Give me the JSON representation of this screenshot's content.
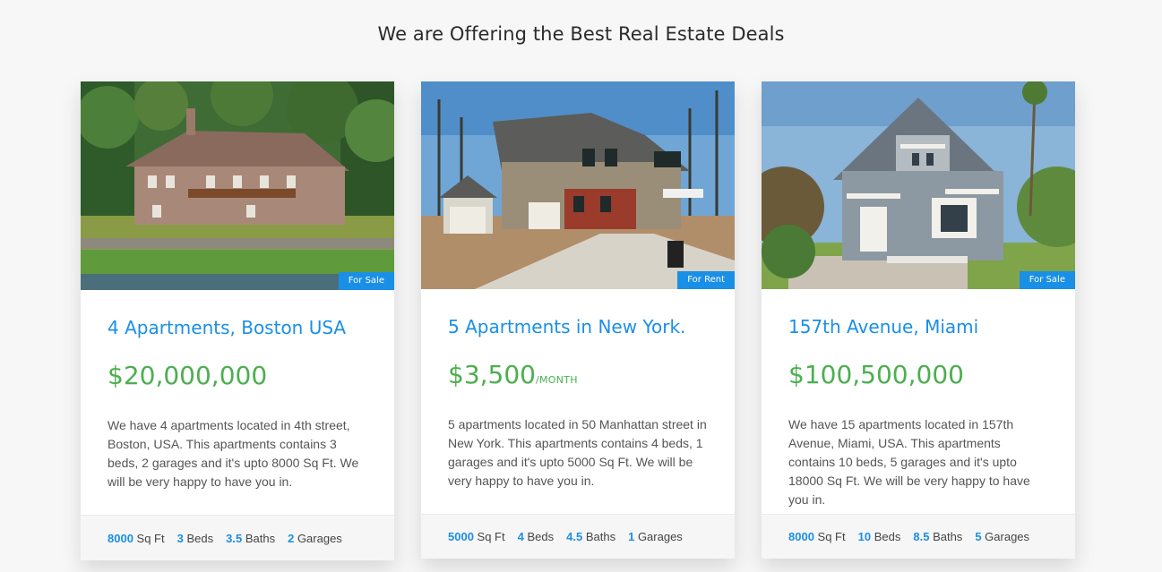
{
  "section": {
    "title": "We are Offering the Best Real Estate Deals"
  },
  "colors": {
    "accent": "#1a8fe6",
    "price": "#4caf50",
    "badge": "#1a8fe6"
  },
  "listings": [
    {
      "image": "house-photo-boston",
      "badge": "For Sale",
      "title": "4 Apartments, Boston USA",
      "price": "$20,000,000",
      "price_unit": "",
      "description": "We have 4 apartments located in 4th street, Boston, USA. This apartments contains 3 beds, 2 garages and it's upto 8000 Sq Ft. We will be very happy to have you in.",
      "features": {
        "sqft": "8000",
        "sqft_label": "Sq Ft",
        "beds": "3",
        "beds_label": "Beds",
        "baths": "3.5",
        "baths_label": "Baths",
        "garages": "2",
        "garages_label": "Garages"
      }
    },
    {
      "image": "house-photo-new-york",
      "badge": "For Rent",
      "title": "5 Apartments in New York.",
      "price": "$3,500",
      "price_unit": "/MONTH",
      "description": "5 apartments located in 50 Manhattan street in New York. This apartments contains 4 beds, 1 garages and it's upto 5000 Sq Ft. We will be very happy to have you in.",
      "features": {
        "sqft": "5000",
        "sqft_label": "Sq Ft",
        "beds": "4",
        "beds_label": "Beds",
        "baths": "4.5",
        "baths_label": "Baths",
        "garages": "1",
        "garages_label": "Garages"
      }
    },
    {
      "image": "house-photo-miami",
      "badge": "For Sale",
      "title": "157th Avenue, Miami",
      "price": "$100,500,000",
      "price_unit": "",
      "description": "We have 15 apartments located in 157th Avenue, Miami, USA. This apartments contains 10 beds, 5 garages and it's upto 18000 Sq Ft. We will be very happy to have you in.",
      "features": {
        "sqft": "8000",
        "sqft_label": "Sq Ft",
        "beds": "10",
        "beds_label": "Beds",
        "baths": "8.5",
        "baths_label": "Baths",
        "garages": "5",
        "garages_label": "Garages"
      }
    }
  ]
}
